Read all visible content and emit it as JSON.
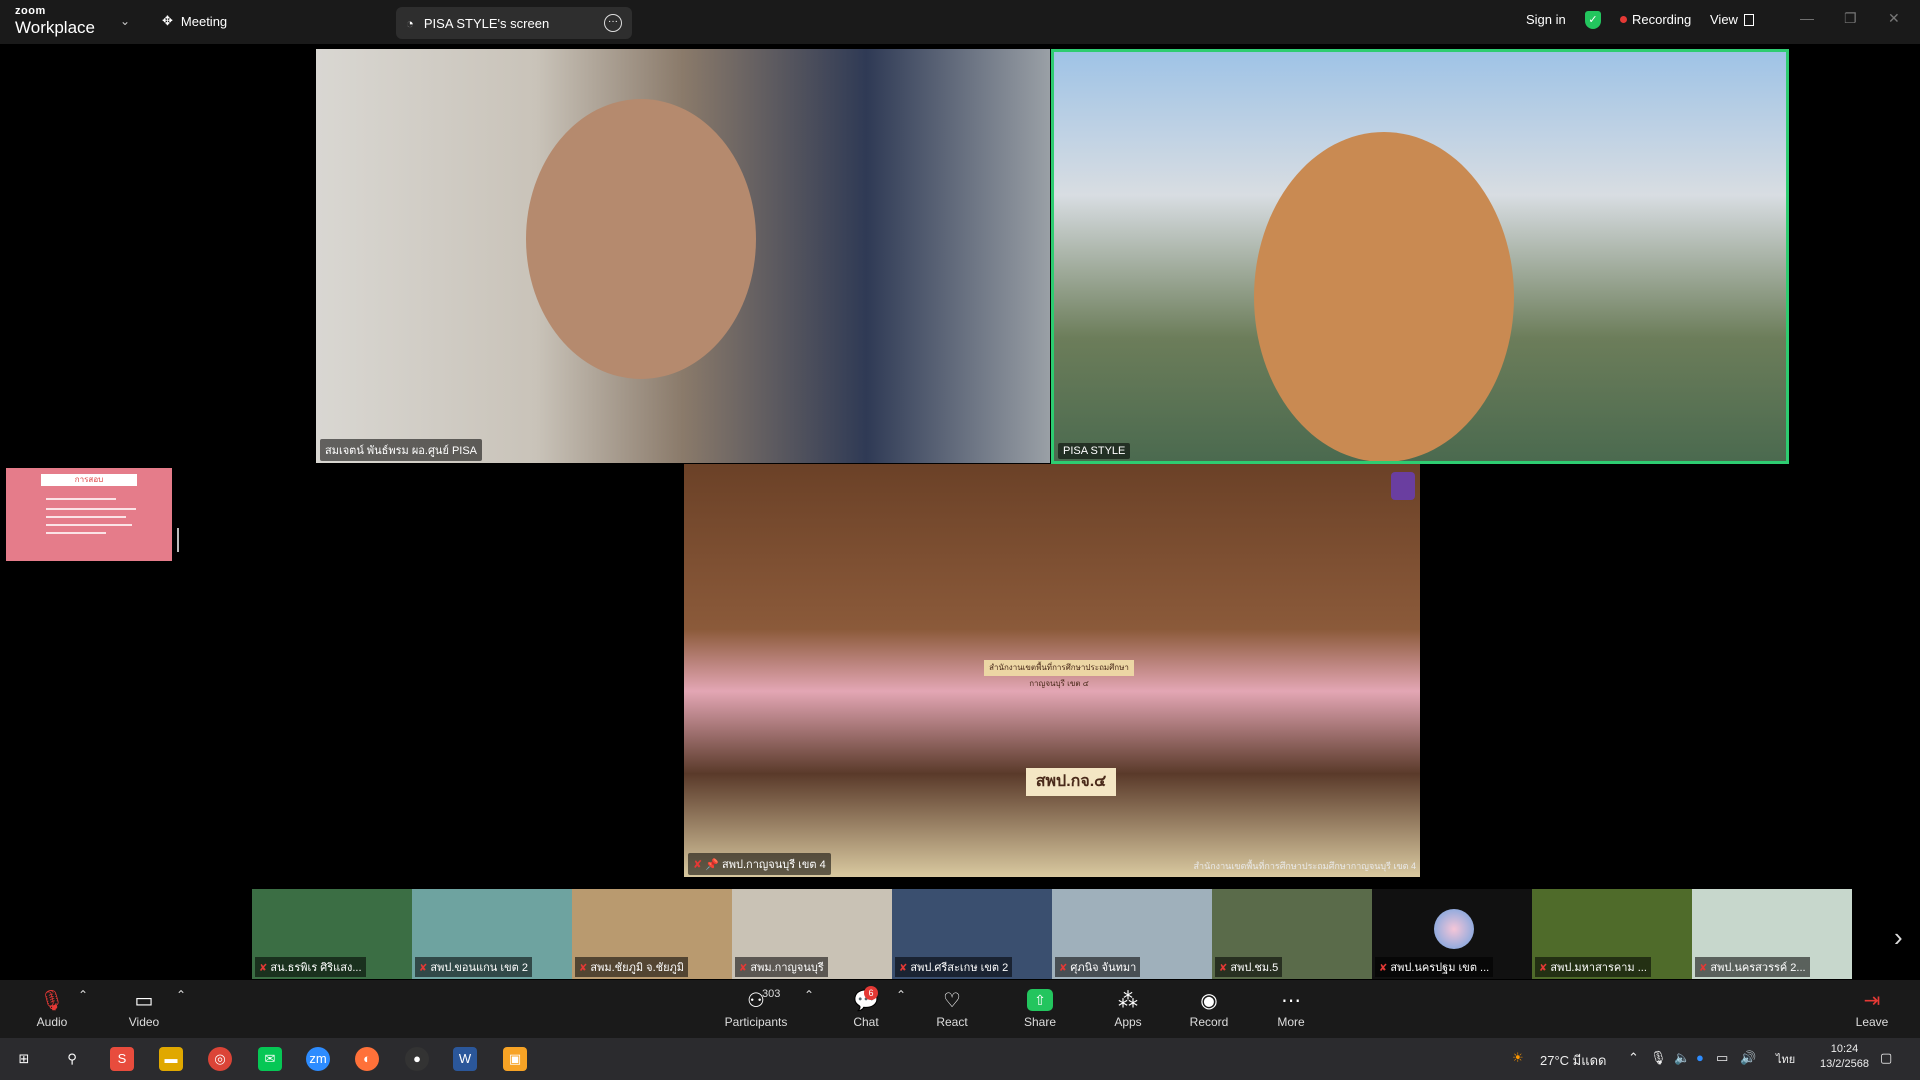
{
  "app": {
    "brand_small": "zoom",
    "brand_name": "Workplace",
    "menu": "Meeting"
  },
  "screen_pill": {
    "title": "PISA STYLE's screen"
  },
  "top_right": {
    "sign_in": "Sign in",
    "recording": "Recording",
    "view": "View"
  },
  "videos": {
    "v1_label": "สมเจตน์ พันธ์พรม ผอ.ศูนย์ PISA",
    "v2_label": "PISA STYLE",
    "v3_label": "สพป.กาญจนบุรี เขต 4",
    "v3_sign": "สำนักงานเขตพื้นที่การศึกษาประถมศึกษากาญจนบุรี เขต ๔",
    "v3_nameplate": "สพป.กจ.๔",
    "v3_watermark": "สำนักงานเขตพื้นที่การศึกษาประถมศึกษากาญจนบุรี เขต 4"
  },
  "strip": [
    {
      "label": "สน.ธรพิเร ศิริแสง...",
      "color": "#3b6e44"
    },
    {
      "label": "สพป.ขอนแกน เขต 2",
      "color": "#6ea3a0"
    },
    {
      "label": "สพม.ชัยภูมิ จ.ชัยภูมิ",
      "color": "#b99a6f"
    },
    {
      "label": "สพม.กาญจนบุรี",
      "color": "#c9c2b5"
    },
    {
      "label": "สพป.ศรีสะเกษ เขต 2",
      "color": "#3a4f6f"
    },
    {
      "label": "ศุภนิจ จันทมา",
      "color": "#9fb0bb"
    },
    {
      "label": "สพป.ชม.5",
      "color": "#5a6b4a"
    },
    {
      "label": "สพป.นครปฐม เขต ...",
      "color": "#111111"
    },
    {
      "label": "สพป.มหาสารคาม ...",
      "color": "#4f6b2a"
    },
    {
      "label": "สพป.นครสวรรค์ 2...",
      "color": "#c7d7cc"
    }
  ],
  "toolbar": {
    "audio": "Audio",
    "video": "Video",
    "participants": "Participants",
    "participants_count": "303",
    "chat": "Chat",
    "chat_badge": "6",
    "react": "React",
    "share": "Share",
    "apps": "Apps",
    "record": "Record",
    "more": "More",
    "leave": "Leave"
  },
  "taskbar": {
    "weather": "27°C มีแดด",
    "lang": "ไทย",
    "time": "10:24",
    "date": "13/2/2568"
  }
}
